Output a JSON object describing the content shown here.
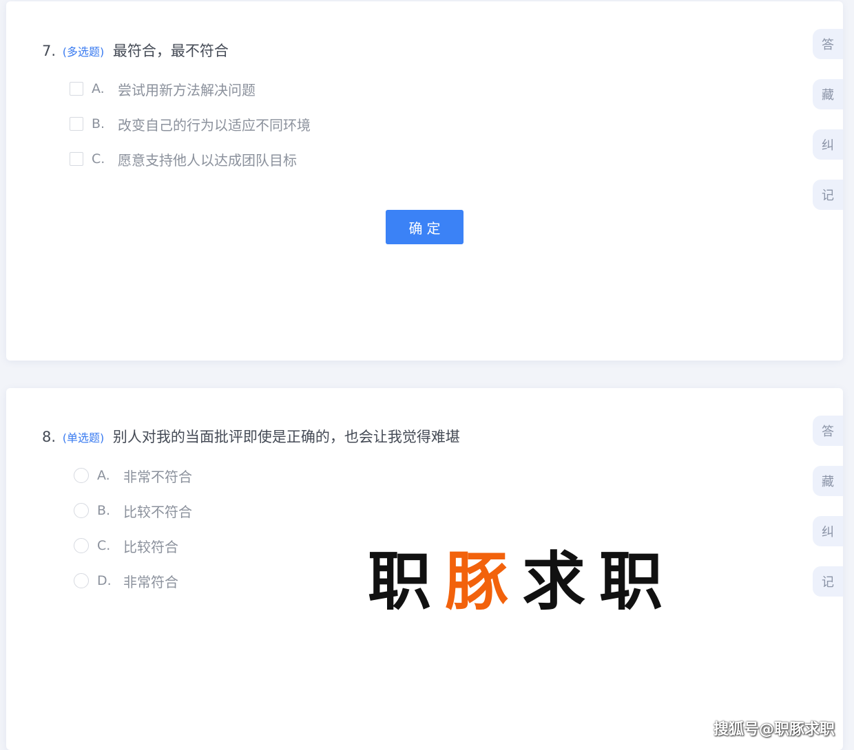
{
  "questions": [
    {
      "number": "7.",
      "type": "(多选题)",
      "text": "最符合，最不符合",
      "options": [
        {
          "letter": "A.",
          "text": "尝试用新方法解决问题"
        },
        {
          "letter": "B.",
          "text": "改变自己的行为以适应不同环境"
        },
        {
          "letter": "C.",
          "text": "愿意支持他人以达成团队目标"
        }
      ],
      "confirm_label": "确定",
      "tools": [
        "答",
        "藏",
        "纠",
        "记"
      ]
    },
    {
      "number": "8.",
      "type": "(单选题)",
      "text": "别人对我的当面批评即使是正确的，也会让我觉得难堪",
      "options": [
        {
          "letter": "A.",
          "text": "非常不符合"
        },
        {
          "letter": "B.",
          "text": "比较不符合"
        },
        {
          "letter": "C.",
          "text": "比较符合"
        },
        {
          "letter": "D.",
          "text": "非常符合"
        }
      ],
      "tools": [
        "答",
        "藏",
        "纠",
        "记"
      ]
    }
  ],
  "logo": {
    "chars": [
      "职",
      "豚",
      "求",
      "职"
    ],
    "colors": {
      "primary": "#111111",
      "accent": "#f2620c"
    }
  },
  "watermark": "搜狐号@职豚求职",
  "colors": {
    "accent": "#3a7bf0",
    "button": "#3b82f6",
    "background": "#f2f4f9"
  }
}
